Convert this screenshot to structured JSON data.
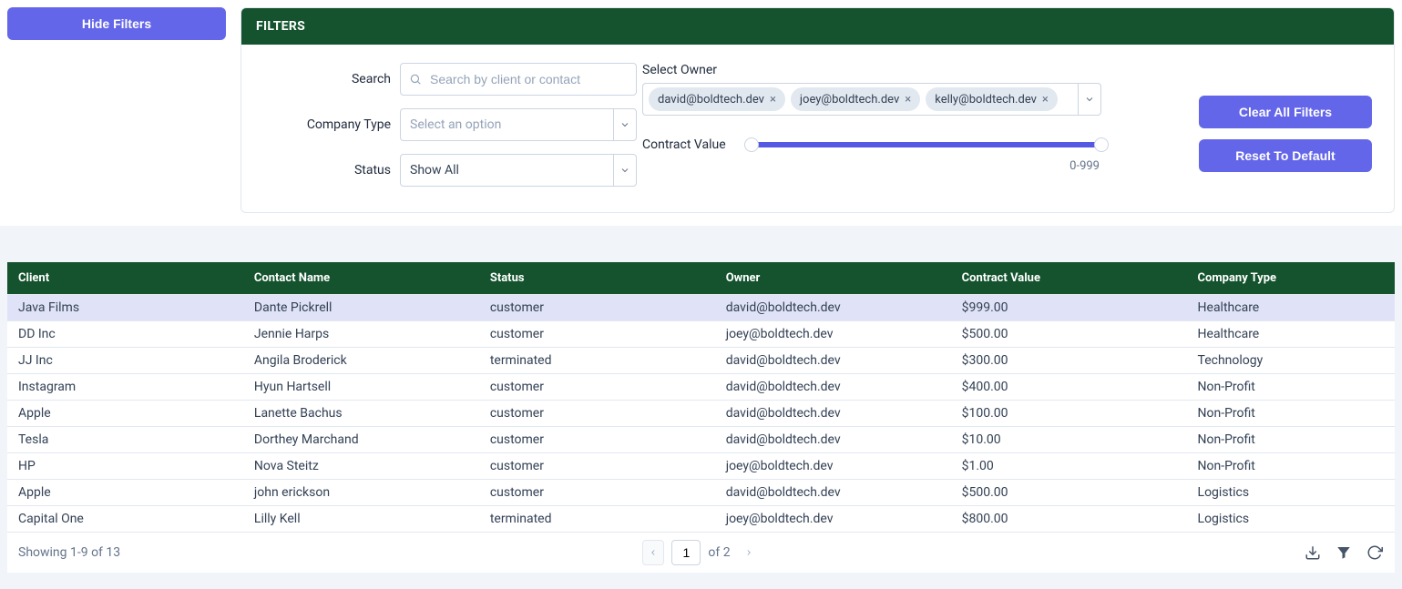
{
  "toggle": {
    "hide_label": "Hide Filters"
  },
  "filters": {
    "header": "FILTERS",
    "search_label": "Search",
    "search_placeholder": "Search by client or contact",
    "company_type_label": "Company Type",
    "company_type_placeholder": "Select an option",
    "status_label": "Status",
    "status_value": "Show All",
    "owner_label": "Select Owner",
    "owner_chips": [
      "david@boldtech.dev",
      "joey@boldtech.dev",
      "kelly@boldtech.dev"
    ],
    "contract_label": "Contract Value",
    "contract_range_text": "0-999",
    "clear_label": "Clear All Filters",
    "reset_label": "Reset To Default"
  },
  "table": {
    "columns": [
      "Client",
      "Contact Name",
      "Status",
      "Owner",
      "Contract Value",
      "Company Type"
    ],
    "rows": [
      {
        "client": "Java Films",
        "contact": "Dante Pickrell",
        "status": "customer",
        "owner": "david@boldtech.dev",
        "value": "$999.00",
        "ctype": "Healthcare",
        "selected": true
      },
      {
        "client": "DD Inc",
        "contact": "Jennie Harps",
        "status": "customer",
        "owner": "joey@boldtech.dev",
        "value": "$500.00",
        "ctype": "Healthcare"
      },
      {
        "client": "JJ Inc",
        "contact": "Angila Broderick",
        "status": "terminated",
        "owner": "david@boldtech.dev",
        "value": "$300.00",
        "ctype": "Technology"
      },
      {
        "client": "Instagram",
        "contact": "Hyun Hartsell",
        "status": "customer",
        "owner": "david@boldtech.dev",
        "value": "$400.00",
        "ctype": "Non-Profit"
      },
      {
        "client": "Apple",
        "contact": "Lanette Bachus",
        "status": "customer",
        "owner": "david@boldtech.dev",
        "value": "$100.00",
        "ctype": "Non-Profit"
      },
      {
        "client": "Tesla",
        "contact": "Dorthey Marchand",
        "status": "customer",
        "owner": "david@boldtech.dev",
        "value": "$10.00",
        "ctype": "Non-Profit"
      },
      {
        "client": "HP",
        "contact": "Nova Steitz",
        "status": "customer",
        "owner": "joey@boldtech.dev",
        "value": "$1.00",
        "ctype": "Non-Profit"
      },
      {
        "client": "Apple",
        "contact": "john erickson",
        "status": "customer",
        "owner": "david@boldtech.dev",
        "value": "$500.00",
        "ctype": "Logistics"
      },
      {
        "client": "Capital One",
        "contact": "Lilly Kell",
        "status": "terminated",
        "owner": "joey@boldtech.dev",
        "value": "$800.00",
        "ctype": "Logistics"
      }
    ]
  },
  "footer": {
    "showing": "Showing 1-9 of 13",
    "page": "1",
    "of_text": "of 2"
  }
}
